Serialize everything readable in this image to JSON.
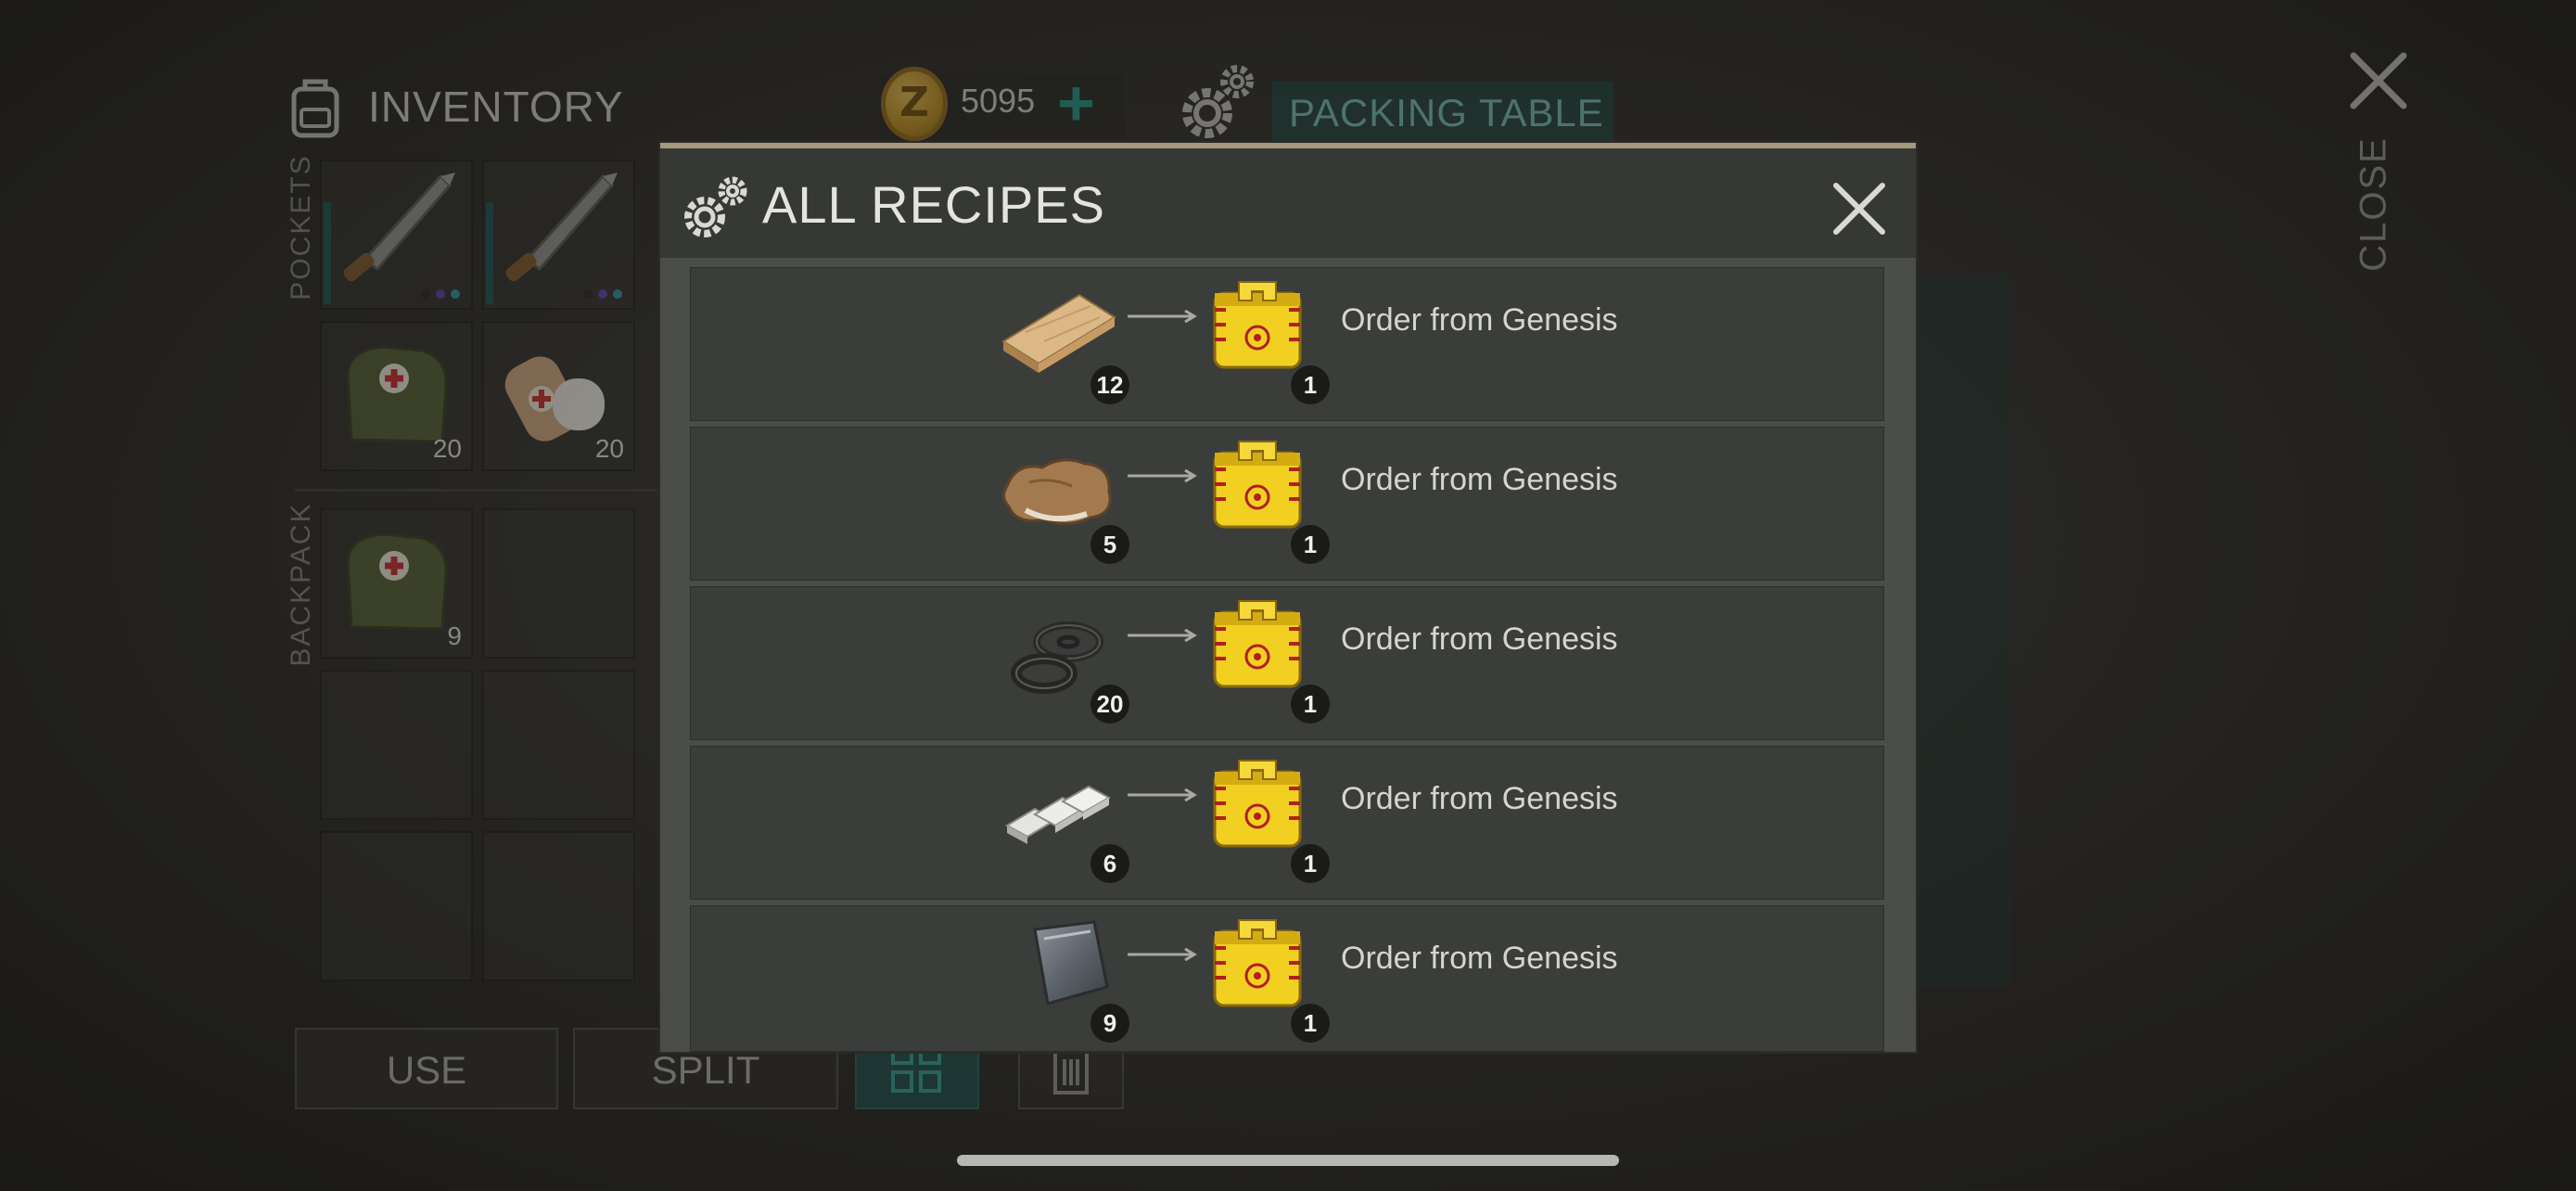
{
  "inventory": {
    "title": "INVENTORY",
    "pockets_label": "POCKETS",
    "backpack_label": "BACKPACK"
  },
  "currency": {
    "amount": "5095",
    "coin_letter": "Z",
    "add_symbol": "+"
  },
  "workbench": {
    "title": "PACKING TABLE"
  },
  "close": {
    "label": "CLOSE"
  },
  "pocket_slots": [
    {
      "icon": "machete-icon",
      "count": ""
    },
    {
      "icon": "machete-icon",
      "count": ""
    },
    {
      "icon": "first-aid-bag-icon",
      "count": "20"
    },
    {
      "icon": "bandage-icon",
      "count": "20"
    }
  ],
  "backpack_slots": [
    {
      "icon": "first-aid-bag-icon",
      "count": "9"
    }
  ],
  "buttons": {
    "use": "USE",
    "split": "SPLIT"
  },
  "modal": {
    "title": "ALL RECIPES",
    "recipes": [
      {
        "ingredient_icon": "wooden-plank-icon",
        "ingredient_count": "12",
        "result_icon": "yellow-crate-icon",
        "result_count": "1",
        "name": "Order from Genesis"
      },
      {
        "ingredient_icon": "animal-hide-icon",
        "ingredient_count": "5",
        "result_icon": "yellow-crate-icon",
        "result_count": "1",
        "name": "Order from Genesis"
      },
      {
        "ingredient_icon": "rubber-rings-icon",
        "ingredient_count": "20",
        "result_icon": "yellow-crate-icon",
        "result_count": "1",
        "name": "Order from Genesis"
      },
      {
        "ingredient_icon": "metal-bars-icon",
        "ingredient_count": "6",
        "result_icon": "yellow-crate-icon",
        "result_count": "1",
        "name": "Order from Genesis"
      },
      {
        "ingredient_icon": "steel-plate-icon",
        "ingredient_count": "9",
        "result_icon": "yellow-crate-icon",
        "result_count": "1",
        "name": "Order from Genesis"
      }
    ]
  },
  "colors": {
    "accent": "#1f8b7d",
    "modal_border": "#a49a7c",
    "crate_yellow": "#f1d021"
  }
}
